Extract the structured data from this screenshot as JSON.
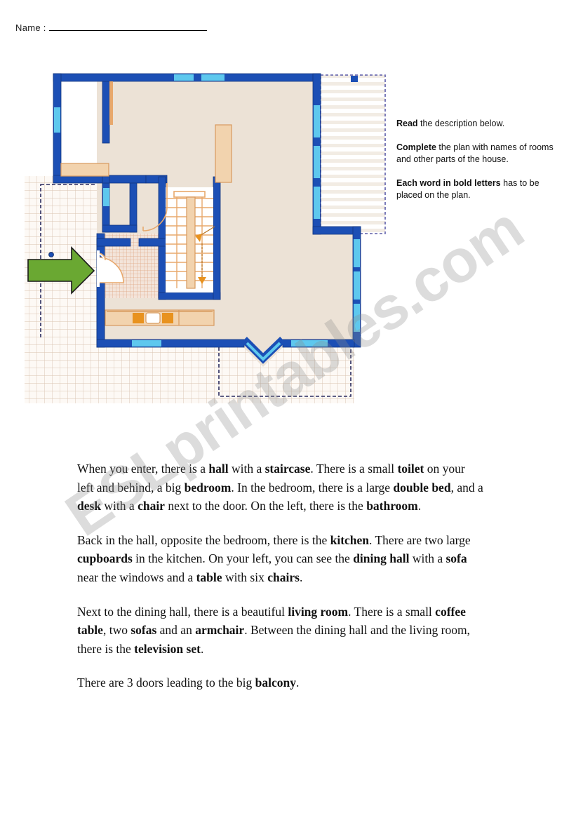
{
  "worksheet": {
    "name_label": "Name :",
    "name_blank": ""
  },
  "instructions": [
    {
      "bold": "Read",
      "rest": " the description below."
    },
    {
      "bold": "Complete",
      "rest": " the plan with names of rooms and other parts of the house."
    },
    {
      "bold": "Each word in bold letters",
      "rest": " has to be placed on the plan."
    }
  ],
  "description": {
    "p1": [
      {
        "t": "When you enter, there is a ",
        "b": false
      },
      {
        "t": "hall",
        "b": true
      },
      {
        "t": " with a ",
        "b": false
      },
      {
        "t": "staircase",
        "b": true
      },
      {
        "t": ". There is a small ",
        "b": false
      },
      {
        "t": "toilet",
        "b": true
      },
      {
        "t": " on your left and behind, a big ",
        "b": false
      },
      {
        "t": "bedroom",
        "b": true
      },
      {
        "t": ". In the bedroom, there is a large ",
        "b": false
      },
      {
        "t": "double bed",
        "b": true
      },
      {
        "t": ", and a ",
        "b": false
      },
      {
        "t": "desk",
        "b": true
      },
      {
        "t": " with a ",
        "b": false
      },
      {
        "t": "chair",
        "b": true
      },
      {
        "t": " next to the door. On the left, there is the ",
        "b": false
      },
      {
        "t": "bathroom",
        "b": true
      },
      {
        "t": ".",
        "b": false
      }
    ],
    "p2": [
      {
        "t": "Back in the hall, opposite the bedroom, there is the ",
        "b": false
      },
      {
        "t": "kitchen",
        "b": true
      },
      {
        "t": ". There are two large ",
        "b": false
      },
      {
        "t": "cupboards",
        "b": true
      },
      {
        "t": "  in the kitchen. On your left, you can see the ",
        "b": false
      },
      {
        "t": "dining hall",
        "b": true
      },
      {
        "t": " with a ",
        "b": false
      },
      {
        "t": "sofa",
        "b": true
      },
      {
        "t": " near the windows and a ",
        "b": false
      },
      {
        "t": "table",
        "b": true
      },
      {
        "t": " with six ",
        "b": false
      },
      {
        "t": "chairs",
        "b": true
      },
      {
        "t": ".",
        "b": false
      }
    ],
    "p3": [
      {
        "t": "Next to the dining hall, there is a beautiful ",
        "b": false
      },
      {
        "t": "living room",
        "b": true
      },
      {
        "t": ". There is a small ",
        "b": false
      },
      {
        "t": "coffee table",
        "b": true
      },
      {
        "t": ", two ",
        "b": false
      },
      {
        "t": "sofas",
        "b": true
      },
      {
        "t": " and an ",
        "b": false
      },
      {
        "t": "armchair",
        "b": true
      },
      {
        "t": ". Between the dining hall and the living room, there is the ",
        "b": false
      },
      {
        "t": "television set",
        "b": true
      },
      {
        "t": ".",
        "b": false
      }
    ],
    "p4": [
      {
        "t": "There are 3 doors leading to the big ",
        "b": false
      },
      {
        "t": "balcony",
        "b": true
      },
      {
        "t": ".",
        "b": false
      }
    ]
  },
  "watermark": {
    "text": "ESLprintables.com"
  },
  "floor_plan": {
    "colors": {
      "wall": "#1c4fb5",
      "wall_dark": "#17408f",
      "room_fill": "#ece2d6",
      "glass": "#5ec8ee",
      "furniture": "#e8a86c",
      "furniture_fill": "#f2d3ae",
      "terrace_grid": "#d9c3b0",
      "arrow_green": "#6aa832",
      "balcony_deck": "#f2ece4"
    },
    "features": [
      "entry-arrow",
      "left-terrace",
      "bottom-terrace",
      "right-balcony",
      "staircase",
      "hall-tiled-floor",
      "bedroom",
      "toilet",
      "bathroom",
      "kitchen-counter",
      "wardrobe",
      "bay-window"
    ],
    "door_count": 3
  }
}
